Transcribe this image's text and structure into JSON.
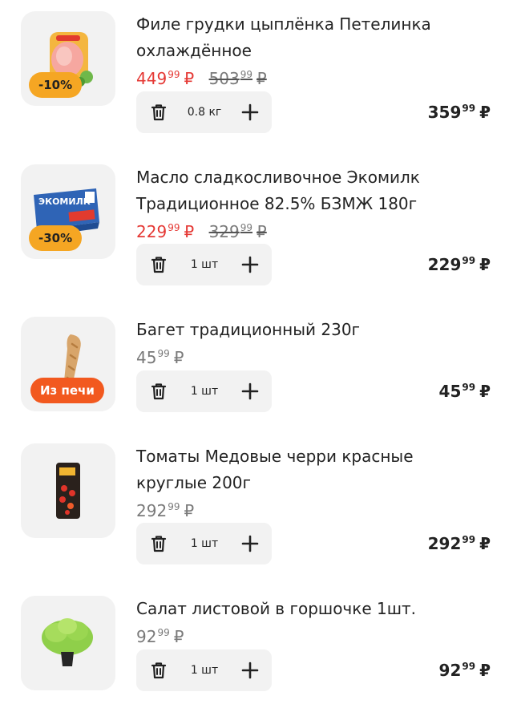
{
  "currency": "₽",
  "items": [
    {
      "title": "Филе грудки цыплёнка Петелинка охлаждённое",
      "badge": "-10%",
      "price_main": "449",
      "price_kop": "99",
      "old_main": "503",
      "old_kop": "99",
      "quantity": "0.8 кг",
      "total_main": "359",
      "total_kop": "99"
    },
    {
      "title": "Масло сладкосливочное Экомилк Традиционное 82.5% БЗМЖ 180г",
      "badge": "-30%",
      "price_main": "229",
      "price_kop": "99",
      "old_main": "329",
      "old_kop": "99",
      "quantity": "1 шт",
      "total_main": "229",
      "total_kop": "99",
      "package_brand": "ЭКОМИЛК"
    },
    {
      "title": "Багет традиционный 230г",
      "badge": "Из печи",
      "price_main": "45",
      "price_kop": "99",
      "quantity": "1 шт",
      "total_main": "45",
      "total_kop": "99"
    },
    {
      "title": "Томаты Медовые черри красные круглые 200г",
      "price_main": "292",
      "price_kop": "99",
      "quantity": "1 шт",
      "total_main": "292",
      "total_kop": "99"
    },
    {
      "title": "Салат листовой в горшочке 1шт.",
      "price_main": "92",
      "price_kop": "99",
      "quantity": "1 шт",
      "total_main": "92",
      "total_kop": "99"
    }
  ],
  "colors": {
    "sale": "#e53935",
    "discount_badge": "#f5a623",
    "oven_badge": "#f2591f",
    "stepper_bg": "#f2f2f2"
  }
}
